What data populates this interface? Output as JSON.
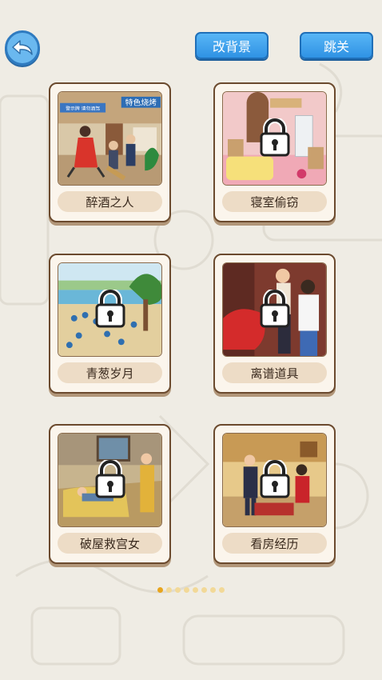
{
  "header": {
    "back_icon": "back-arrow-icon",
    "change_background_label": "改背景",
    "skip_label": "跳关"
  },
  "levels": [
    {
      "title": "醉酒之人",
      "locked": false
    },
    {
      "title": "寝室偷窃",
      "locked": true
    },
    {
      "title": "青葱岁月",
      "locked": true
    },
    {
      "title": "离谱道具",
      "locked": true
    },
    {
      "title": "破屋救宫女",
      "locked": true
    },
    {
      "title": "看房经历",
      "locked": true
    }
  ],
  "shop_sign_text": "特色烧烤",
  "street_sign_text": "警示牌 请勿酒驾",
  "pagination": {
    "total": 8,
    "current": 1
  },
  "colors": {
    "accent_blue": "#2f92e4",
    "card_border": "#6b4a2e",
    "dot_active": "#e8a51e"
  }
}
